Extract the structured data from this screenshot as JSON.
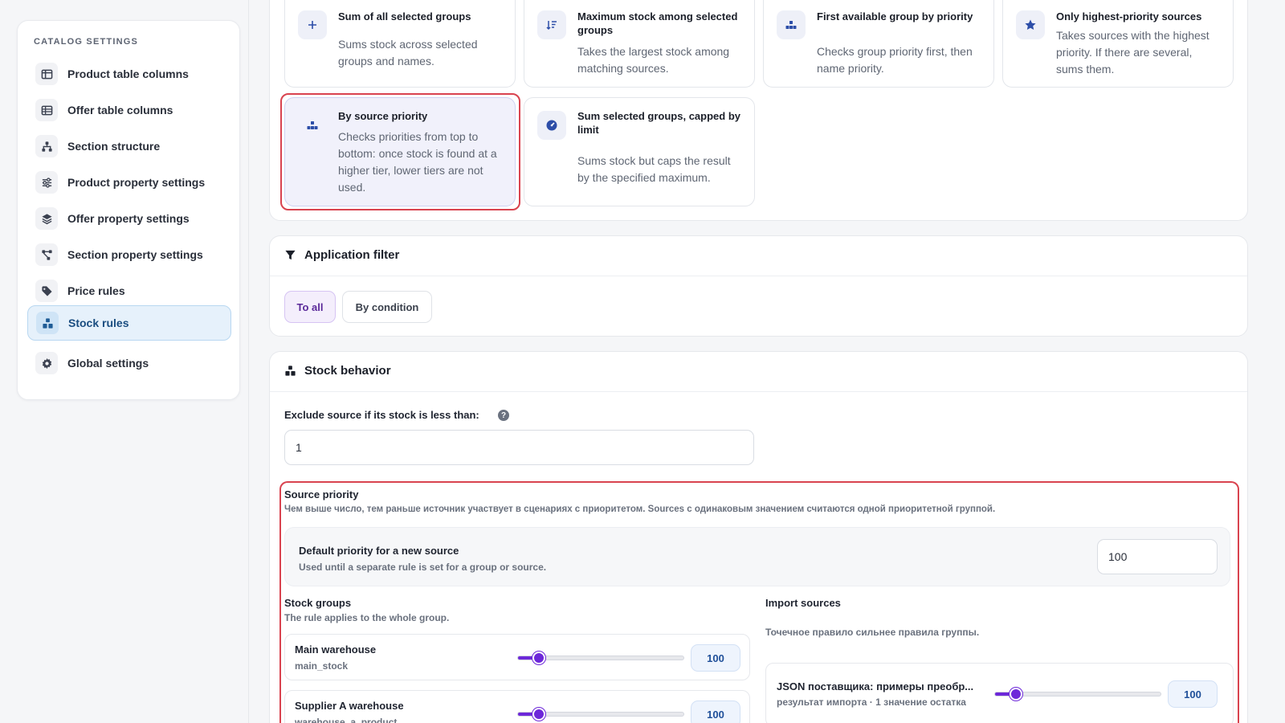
{
  "sidebar": {
    "title": "CATALOG SETTINGS",
    "items": [
      {
        "label": "Product table columns",
        "icon": "columns-icon"
      },
      {
        "label": "Offer table columns",
        "icon": "table-icon"
      },
      {
        "label": "Section structure",
        "icon": "sitemap-icon"
      },
      {
        "label": "Product property settings",
        "icon": "sliders-icon"
      },
      {
        "label": "Offer property settings",
        "icon": "layers-icon"
      },
      {
        "label": "Section property settings",
        "icon": "share-nodes-icon"
      },
      {
        "label": "Price rules",
        "icon": "tag-icon"
      },
      {
        "label": "Stock rules",
        "icon": "boxes-icon",
        "active": true
      },
      {
        "label": "Global settings",
        "icon": "gear-icon"
      }
    ]
  },
  "strategies": [
    {
      "title": "Sum of all selected groups",
      "desc": "Sums stock across selected groups and names.",
      "icon": "plus-icon"
    },
    {
      "title": "Maximum stock among selected groups",
      "desc": "Takes the largest stock among matching sources.",
      "icon": "sort-desc-icon"
    },
    {
      "title": "First available group by priority",
      "desc": "Checks group priority first, then name priority.",
      "icon": "priority-blocks-icon"
    },
    {
      "title": "Only highest-priority sources",
      "desc": "Takes sources with the highest priority. If there are several, sums them.",
      "icon": "star-icon"
    },
    {
      "title": "By source priority",
      "desc": "Checks priorities from top to bottom: once stock is found at a higher tier, lower tiers are not used.",
      "icon": "priority-blocks-icon",
      "selected": true
    },
    {
      "title": "Sum selected groups, capped by limit",
      "desc": "Sums stock but caps the result by the specified maximum.",
      "icon": "gauge-icon"
    }
  ],
  "filter": {
    "title": "Application filter",
    "options": [
      {
        "label": "To all",
        "active": true
      },
      {
        "label": "By condition",
        "active": false
      }
    ]
  },
  "behavior": {
    "title": "Stock behavior",
    "exclude_label": "Exclude source if its stock is less than:",
    "exclude_value": "1",
    "help": "?"
  },
  "priority": {
    "title": "Source priority",
    "desc": "Чем выше число, тем раньше источник участвует в сценариях с приоритетом. Sources с одинаковым значением считаются одной приоритетной группой.",
    "default_label": "Default priority for a new source",
    "default_sub": "Used until a separate rule is set for a group or source.",
    "default_value": "100",
    "groups_title": "Stock groups",
    "groups_sub": "The rule applies to the whole group.",
    "groups": [
      {
        "name": "Main warehouse",
        "code": "main_stock",
        "value": "100",
        "level": 0.1
      },
      {
        "name": "Supplier A warehouse",
        "code": "warehouse_a_product",
        "value": "100",
        "level": 0.1
      }
    ],
    "sources_title": "Import sources",
    "sources_sub": "Точечное правило сильнее правила группы.",
    "sources": [
      {
        "name": "JSON поставщика: примеры преобр...",
        "meta": "результат импорта · 1 значение остатка",
        "value": "100",
        "level": 0.1
      }
    ]
  },
  "colors": {
    "accent": "#6d28d9",
    "highlight": "#d9434f",
    "active_nav": "#e6f1fb"
  }
}
